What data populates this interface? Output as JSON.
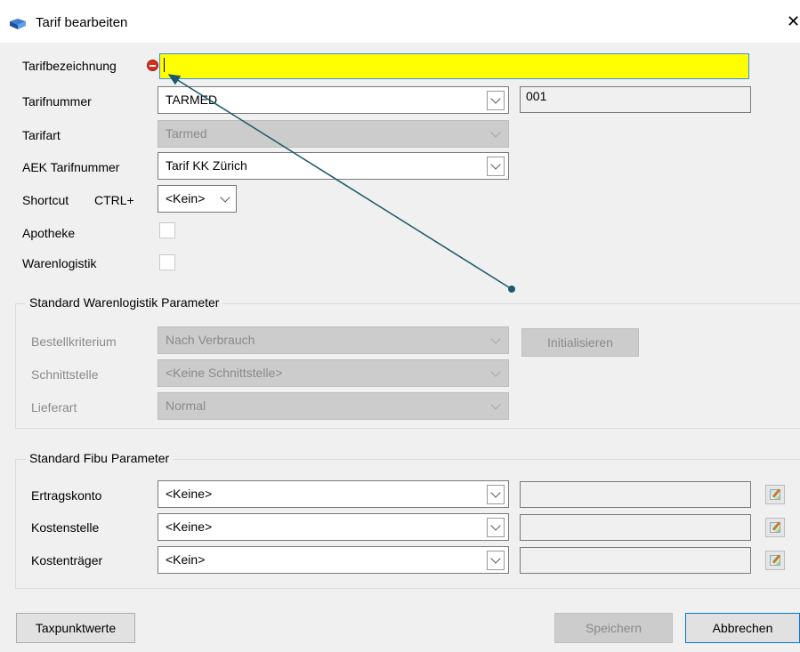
{
  "window": {
    "title": "Tarif bearbeiten",
    "close_glyph": "✕",
    "icon": "book-icon"
  },
  "form": {
    "tarifbezeichnung": {
      "label": "Tarifbezeichnung",
      "value": "",
      "required_icon": "required-icon",
      "highlight_color": "#ffff00"
    },
    "tarifnummer": {
      "label": "Tarifnummer",
      "value": "TARMED",
      "number": "001"
    },
    "tarifart": {
      "label": "Tarifart",
      "value": "Tarmed"
    },
    "aek_tarifnummer": {
      "label": "AEK Tarifnummer",
      "value": "Tarif KK Zürich"
    },
    "shortcut": {
      "label": "Shortcut",
      "modifier": "CTRL+",
      "value": "<Kein>"
    },
    "apotheke": {
      "label": "Apotheke",
      "checked": false
    },
    "warenlogistik": {
      "label": "Warenlogistik",
      "checked": false
    }
  },
  "warenlogistik_group": {
    "title": "Standard Warenlogistik Parameter",
    "bestellkriterium": {
      "label": "Bestellkriterium",
      "value": "Nach Verbrauch"
    },
    "schnittstelle": {
      "label": "Schnittstelle",
      "value": "<Keine Schnittstelle>"
    },
    "lieferart": {
      "label": "Lieferart",
      "value": "Normal"
    },
    "initialize_button": "Initialisieren"
  },
  "fibu_group": {
    "title": "Standard Fibu Parameter",
    "rows": [
      {
        "label": "Ertragskonto",
        "value": "<Keine>",
        "detail": ""
      },
      {
        "label": "Kostenstelle",
        "value": "<Keine>",
        "detail": ""
      },
      {
        "label": "Kostenträger",
        "value": "<Kein>",
        "detail": ""
      }
    ]
  },
  "footer": {
    "taxpunktwerte_button": "Taxpunktwerte",
    "save_button": "Speichern",
    "cancel_button": "Abbrechen"
  },
  "annotation": {
    "color": "#1f5a6b"
  }
}
